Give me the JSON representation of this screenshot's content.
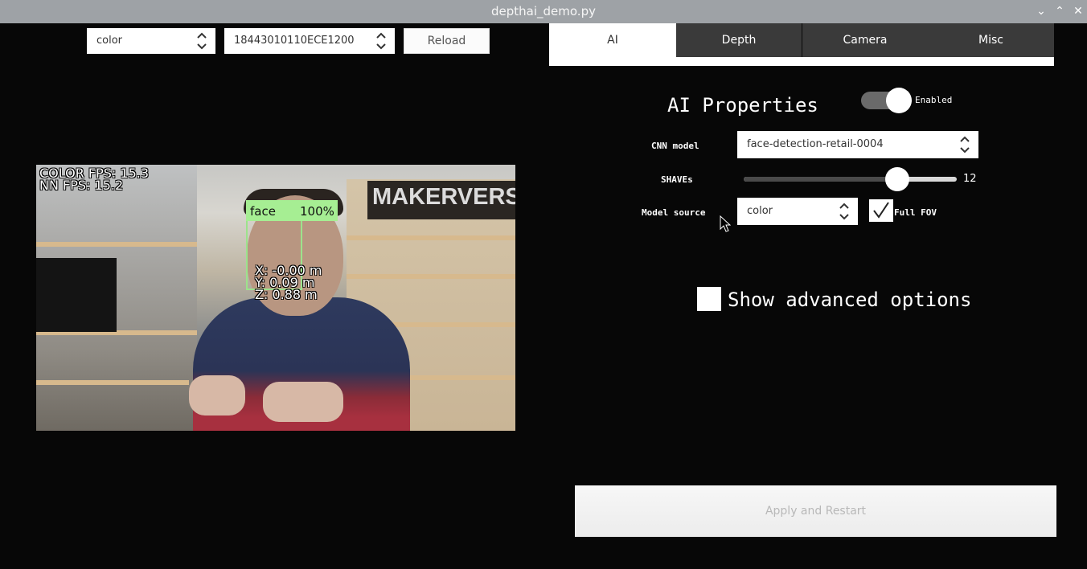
{
  "window": {
    "title": "depthai_demo.py",
    "minimize_glyph": "⌄",
    "maximize_glyph": "⌃",
    "close_glyph": "✕"
  },
  "toolbar": {
    "source_select": "color",
    "device_select": "18443010110ECE1200",
    "reload_label": "Reload"
  },
  "preview": {
    "fps_color": "COLOR FPS: 15.3",
    "fps_nn": "NN FPS:  15.2",
    "detection_label": "face",
    "detection_conf": "100%",
    "coord_x": "X: -0.00 m",
    "coord_y": "Y: 0.09 m",
    "coord_z": "Z: 0.88 m",
    "sign_text": "MAKERVERSE"
  },
  "tabs": [
    {
      "label": "AI",
      "active": true
    },
    {
      "label": "Depth",
      "active": false
    },
    {
      "label": "Camera",
      "active": false
    },
    {
      "label": "Misc",
      "active": false
    }
  ],
  "ai": {
    "heading": "AI Properties",
    "enabled_label": "Enabled",
    "enabled": true,
    "cnn_model_label": "CNN model",
    "cnn_model_value": "face-detection-retail-0004",
    "shaves_label": "SHAVEs",
    "shaves_value": "12",
    "shaves_fraction": 0.72,
    "model_source_label": "Model source",
    "model_source_value": "color",
    "full_fov_label": "Full FOV",
    "full_fov_checked": true,
    "show_advanced_label": "Show advanced options",
    "show_advanced_checked": false
  },
  "apply_label": "Apply and Restart",
  "colors": {
    "background": "#070707",
    "titlebar": "#9ea2a6",
    "tab_active": "#ffffff",
    "tab_inactive": "#3a3a3a",
    "bbox": "#a6ee93"
  }
}
